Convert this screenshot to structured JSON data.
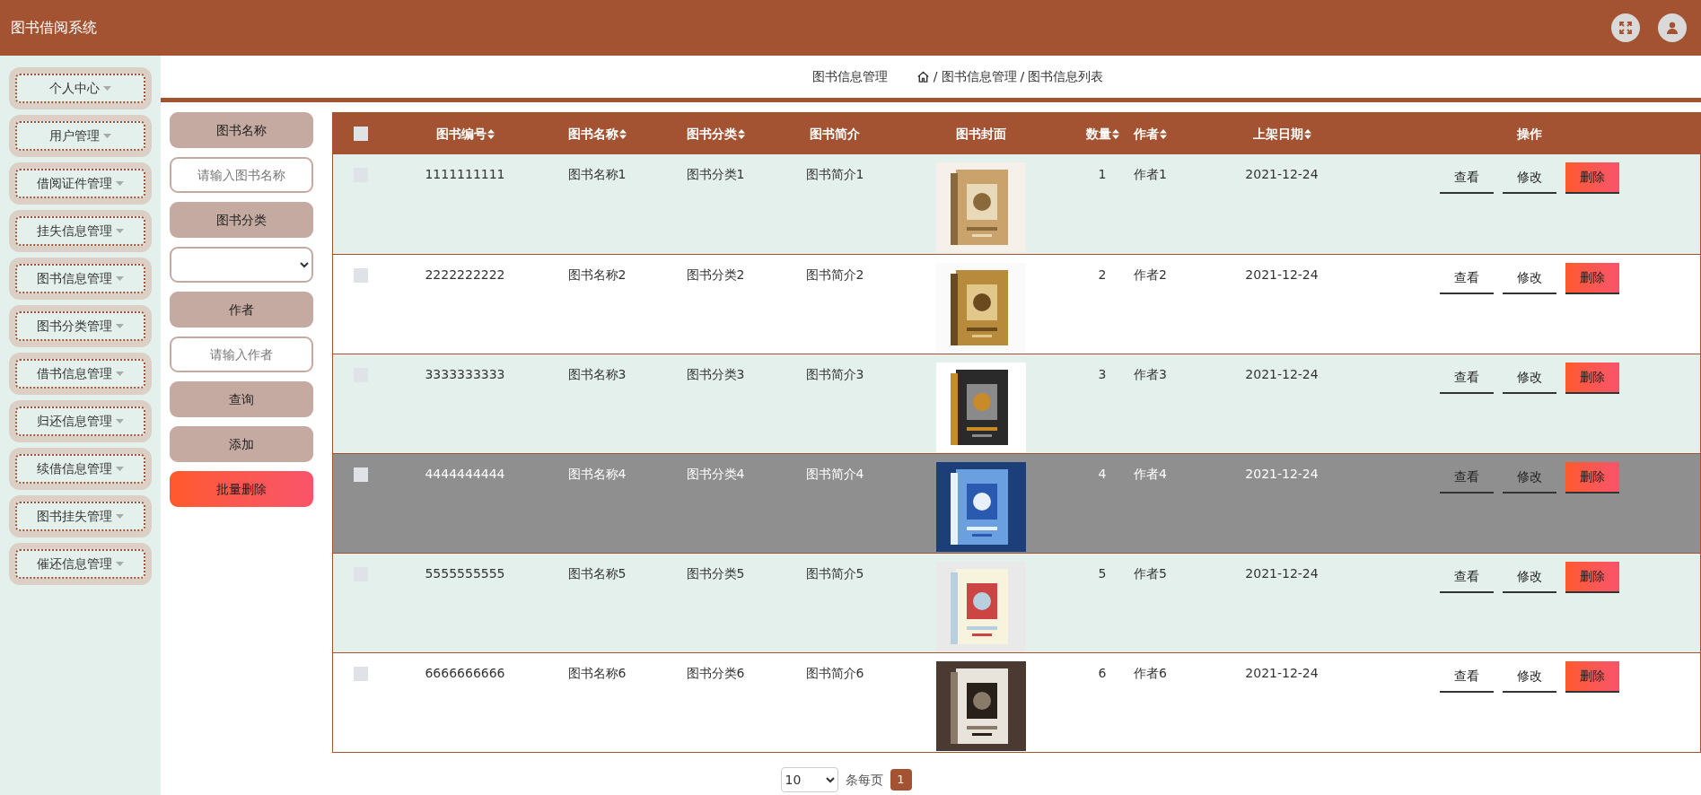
{
  "app_title": "图书借阅系统",
  "sidebar": {
    "items": [
      {
        "label": "个人中心"
      },
      {
        "label": "用户管理"
      },
      {
        "label": "借阅证件管理"
      },
      {
        "label": "挂失信息管理"
      },
      {
        "label": "图书信息管理"
      },
      {
        "label": "图书分类管理"
      },
      {
        "label": "借书信息管理"
      },
      {
        "label": "归还信息管理"
      },
      {
        "label": "续借信息管理"
      },
      {
        "label": "图书挂失管理"
      },
      {
        "label": "催还信息管理"
      }
    ]
  },
  "breadcrumb": {
    "title": "图书信息管理",
    "path": [
      {
        "separator": "/",
        "label": "图书信息管理"
      },
      {
        "separator": "/",
        "label": "图书信息列表"
      }
    ]
  },
  "filters": [
    {
      "kind": "label",
      "text": "图书名称"
    },
    {
      "kind": "input",
      "placeholder": "请输入图书名称"
    },
    {
      "kind": "label",
      "text": "图书分类"
    },
    {
      "kind": "select"
    },
    {
      "kind": "label",
      "text": "作者"
    },
    {
      "kind": "input",
      "placeholder": "请输入作者"
    },
    {
      "kind": "button",
      "text": "查询"
    },
    {
      "kind": "button",
      "text": "添加"
    },
    {
      "kind": "danger",
      "text": "批量删除"
    }
  ],
  "table": {
    "select_all": {
      "checked": false
    },
    "columns": [
      {
        "label": "图书编号",
        "sortable": true
      },
      {
        "label": "图书名称",
        "sortable": true
      },
      {
        "label": "图书分类",
        "sortable": true
      },
      {
        "label": "图书简介",
        "sortable": false
      },
      {
        "label": "图书封面",
        "sortable": false
      },
      {
        "label": "数量",
        "sortable": true
      },
      {
        "label": "作者",
        "sortable": true
      },
      {
        "label": "上架日期",
        "sortable": true
      },
      {
        "label": "操作",
        "sortable": false
      }
    ],
    "rows": [
      {
        "checked": false,
        "highlighted": false,
        "cells": [
          "1111111111",
          "图书名称1",
          "图书分类1",
          "图书简介1",
          {
            "kind": "picture"
          },
          "1",
          "作者1",
          "2021-12-24",
          {
            "kind": "actions",
            "actions": [
              {
                "kind": "view",
                "label": "查看"
              },
              {
                "kind": "edit",
                "label": "修改"
              },
              {
                "kind": "delete",
                "label": "删除"
              }
            ]
          }
        ]
      },
      {
        "checked": false,
        "highlighted": false,
        "cells": [
          "2222222222",
          "图书名称2",
          "图书分类2",
          "图书简介2",
          {
            "kind": "picture"
          },
          "2",
          "作者2",
          "2021-12-24",
          {
            "kind": "actions",
            "actions": [
              {
                "kind": "view",
                "label": "查看"
              },
              {
                "kind": "edit",
                "label": "修改"
              },
              {
                "kind": "delete",
                "label": "删除"
              }
            ]
          }
        ]
      },
      {
        "checked": false,
        "highlighted": false,
        "cells": [
          "3333333333",
          "图书名称3",
          "图书分类3",
          "图书简介3",
          {
            "kind": "picture"
          },
          "3",
          "作者3",
          "2021-12-24",
          {
            "kind": "actions",
            "actions": [
              {
                "kind": "view",
                "label": "查看"
              },
              {
                "kind": "edit",
                "label": "修改"
              },
              {
                "kind": "delete",
                "label": "删除"
              }
            ]
          }
        ]
      },
      {
        "checked": false,
        "highlighted": true,
        "cells": [
          "4444444444",
          "图书名称4",
          "图书分类4",
          "图书简介4",
          {
            "kind": "picture"
          },
          "4",
          "作者4",
          "2021-12-24",
          {
            "kind": "actions",
            "actions": [
              {
                "kind": "view",
                "label": "查看"
              },
              {
                "kind": "edit",
                "label": "修改"
              },
              {
                "kind": "delete",
                "label": "删除"
              }
            ]
          }
        ]
      },
      {
        "checked": false,
        "highlighted": false,
        "cells": [
          "5555555555",
          "图书名称5",
          "图书分类5",
          "图书简介5",
          {
            "kind": "picture"
          },
          "5",
          "作者5",
          "2021-12-24",
          {
            "kind": "actions",
            "actions": [
              {
                "kind": "view",
                "label": "查看"
              },
              {
                "kind": "edit",
                "label": "修改"
              },
              {
                "kind": "delete",
                "label": "删除"
              }
            ]
          }
        ]
      },
      {
        "checked": false,
        "highlighted": false,
        "cells": [
          "6666666666",
          "图书名称6",
          "图书分类6",
          "图书简介6",
          {
            "kind": "picture"
          },
          "6",
          "作者6",
          "2021-12-24",
          {
            "kind": "actions",
            "actions": [
              {
                "kind": "view",
                "label": "查看"
              },
              {
                "kind": "edit",
                "label": "修改"
              },
              {
                "kind": "delete",
                "label": "删除"
              }
            ]
          }
        ]
      }
    ]
  },
  "pagination": {
    "page_size": "10",
    "page_size_label": "条每页",
    "pages": [
      {
        "label": "1",
        "selected": true
      }
    ]
  }
}
